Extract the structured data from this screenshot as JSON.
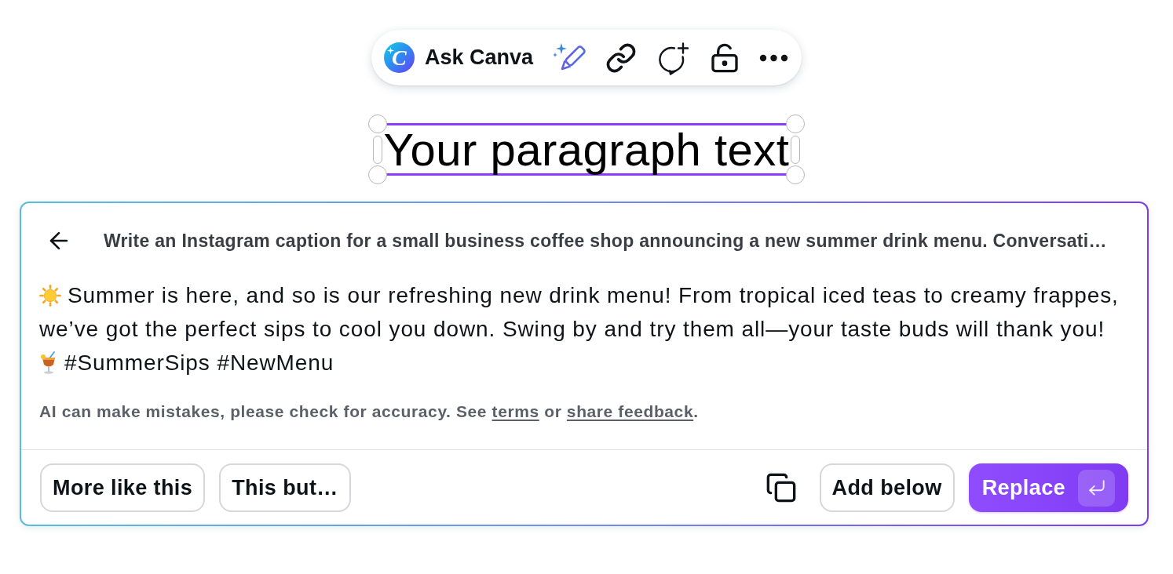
{
  "toolbar": {
    "logo_letter": "C",
    "label": "Ask Canva",
    "actions": [
      {
        "kind": "magic_edit"
      },
      {
        "kind": "link"
      },
      {
        "kind": "comment"
      },
      {
        "kind": "unlock"
      },
      {
        "kind": "more"
      }
    ]
  },
  "text_element": {
    "text": "Your paragraph text",
    "selected": true
  },
  "assistant_panel": {
    "prompt": "Write an Instagram caption for a small business coffee shop announcing a new summer drink menu. Conversati…",
    "response": {
      "lines": [
        "Summer is here, and so is our refreshing new drink menu! From tropical iced teas to creamy frappes,",
        "we’ve got the perfect sips to cool you down. Swing by and try them all—your taste buds will thank you!"
      ],
      "hashtags": "#SummerSips #NewMenu"
    },
    "disclaimer": [
      {
        "kind": "text",
        "text": "AI can make mistakes, please check for accuracy. See "
      },
      {
        "kind": "link",
        "text": "terms"
      },
      {
        "kind": "text",
        "text": " or "
      },
      {
        "kind": "link",
        "text": "share feedback"
      },
      {
        "kind": "text",
        "text": "."
      }
    ],
    "refine_buttons": [
      "More like this",
      "This but…"
    ],
    "action_buttons": [
      {
        "label": "Add below",
        "kind": "secondary"
      },
      {
        "label": "Replace",
        "kind": "primary"
      }
    ]
  }
}
